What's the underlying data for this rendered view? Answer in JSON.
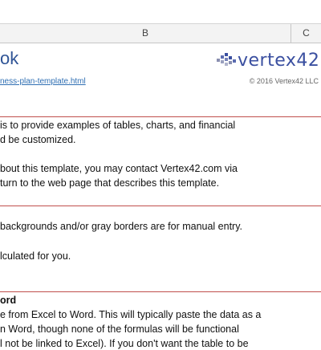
{
  "columns": {
    "b": "B",
    "c": "C"
  },
  "header": {
    "title": "ok",
    "logo_text": "vertex42",
    "link_text": "ness-plan-template.html",
    "copyright": "© 2016 Vertex42 LLC"
  },
  "paragraphs": [
    "is to provide examples of tables, charts, and financial",
    "d be customized.",
    "bout this template, you may contact Vertex42.com via",
    "turn to the web page that describes this template.",
    "backgrounds and/or gray borders are for manual entry.",
    "lculated for you.",
    "ord",
    "e from Excel to Word. This will typically paste the data as a",
    "n Word, though none of the formulas will be functional",
    "l not be linked to Excel). If you don't want the table to be"
  ],
  "colors": {
    "accent": "#2f5496",
    "divider": "#c0504d",
    "link": "#2f6fb3"
  }
}
